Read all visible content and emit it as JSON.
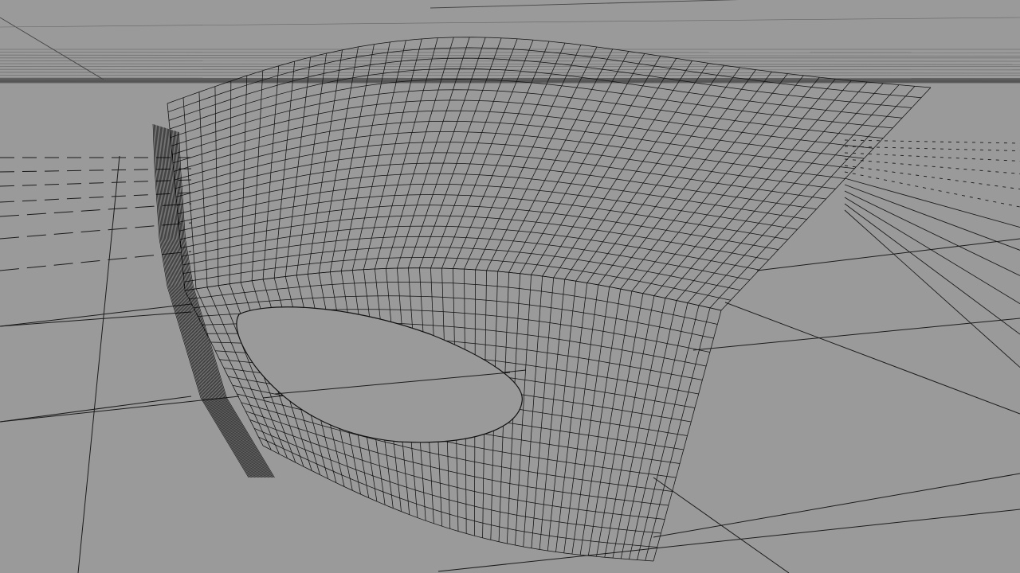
{
  "viewport": {
    "background_color": "#9a9a9a",
    "wire_color": "#111111",
    "grid_color": "#1b1b1b",
    "horizon_band_color": "#6f6f6f"
  },
  "scene": {
    "object_name": "wireframe-mask-surface",
    "display_mode": "wireframe",
    "ground_grid": "visible"
  }
}
